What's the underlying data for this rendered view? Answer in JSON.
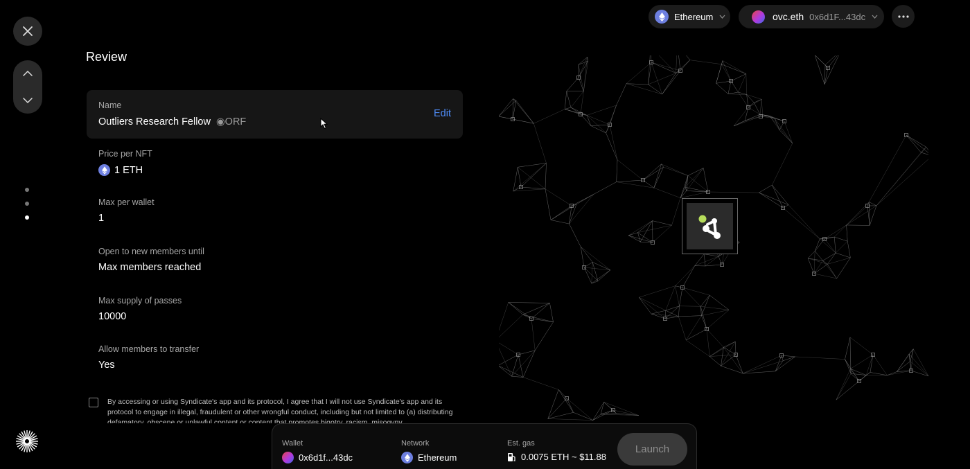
{
  "header": {
    "network": {
      "label": "Ethereum"
    },
    "account": {
      "ens": "ovc.eth",
      "address": "0x6d1F...43dc"
    }
  },
  "page": {
    "title": "Review"
  },
  "review": {
    "name": {
      "label": "Name",
      "value": "Outliers Research Fellow",
      "symbol": "◉ORF",
      "edit_label": "Edit"
    },
    "price": {
      "label": "Price per NFT",
      "value": "1 ETH"
    },
    "max_per_wallet": {
      "label": "Max per wallet",
      "value": "1"
    },
    "open_until": {
      "label": "Open to new members until",
      "value": "Max members reached"
    },
    "max_supply": {
      "label": "Max supply of passes",
      "value": "10000"
    },
    "transfer": {
      "label": "Allow members to transfer",
      "value": "Yes"
    }
  },
  "terms": {
    "checked": false,
    "text": "By accessing or using Syndicate's app and its protocol, I agree that I will not use Syndicate's app and its protocol to engage in illegal, fraudulent or other wrongful conduct, including but not limited to (a) distributing defamatory, obscene or unlawful content or content that promotes bigotry, racism, misogyny"
  },
  "progress": {
    "steps": 3,
    "active_step": 3
  },
  "footer": {
    "wallet": {
      "label": "Wallet",
      "value": "0x6d1f...43dc"
    },
    "network": {
      "label": "Network",
      "value": "Ethereum"
    },
    "gas": {
      "label": "Est. gas",
      "value": "0.0075 ETH ~ $11.88"
    },
    "launch_label": "Launch"
  },
  "colors": {
    "accent": "#4f8cf7",
    "background": "#000000",
    "card": "#161616",
    "eth_badge": "#6d7fe0"
  }
}
